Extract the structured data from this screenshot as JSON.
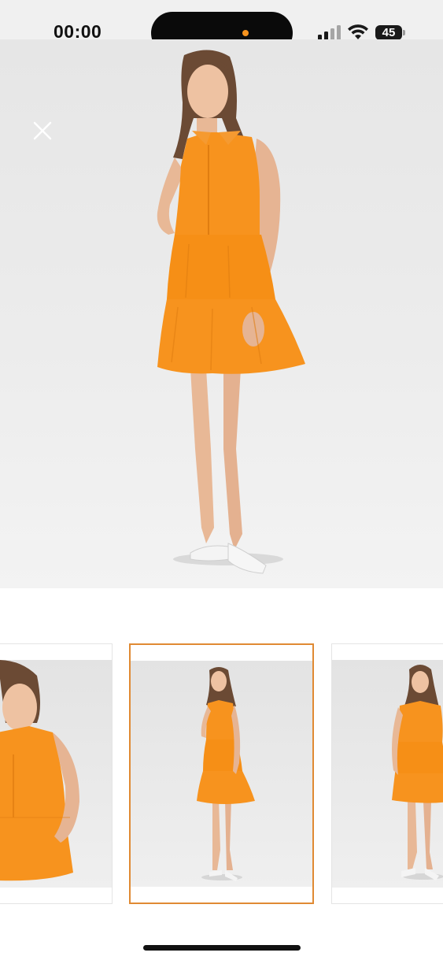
{
  "status_bar": {
    "time": "00:00",
    "battery_level": "45",
    "icons": [
      "signal-icon",
      "wifi-icon",
      "battery-icon"
    ],
    "island_dot_color": "#f7931e"
  },
  "viewer": {
    "close_icon": "close-icon",
    "main_image": "model-orange-sleeveless-tiered-mini-dress-front"
  },
  "thumbnails": [
    {
      "image": "model-orange-dress-close-side",
      "selected": false
    },
    {
      "image": "model-orange-dress-full-front",
      "selected": true
    },
    {
      "image": "model-orange-dress-full-angle",
      "selected": false
    }
  ],
  "colors": {
    "accent": "#e08a33",
    "dress": "#f7931e",
    "background": "#ececec"
  }
}
